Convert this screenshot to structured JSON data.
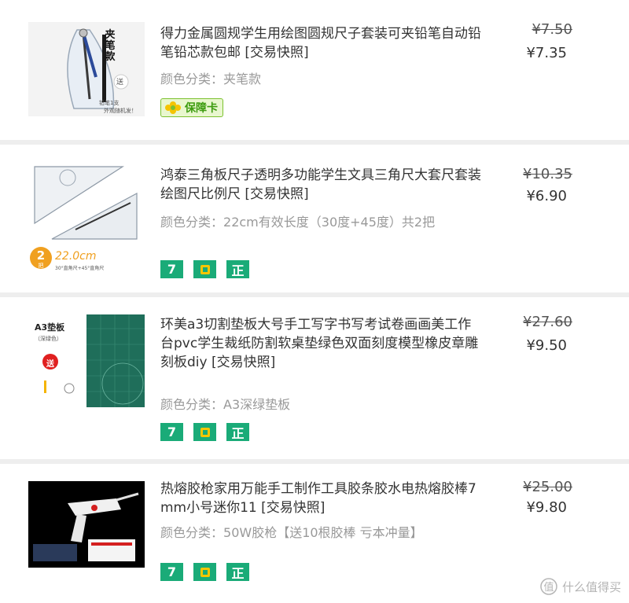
{
  "products": [
    {
      "title": "得力金属圆规学生用绘图圆规尺子套装可夹铅笔自动铅笔铅芯款包邮 [交易快照]",
      "variant_label": "颜色分类：",
      "variant_value": "夹笔款",
      "original_price": "¥7.50",
      "price": "¥7.35",
      "thumb_text": [
        "夹笔款",
        "送",
        "铅笔1支",
        "外观随机发！"
      ],
      "warranty_label": "保障卡"
    },
    {
      "title": "鸿泰三角板尺子透明多功能学生文具三角尺大套尺套装绘图尺比例尺 [交易快照]",
      "variant_label": "颜色分类：",
      "variant_value": "22cm有效长度（30度+45度）共2把",
      "original_price": "¥10.35",
      "price": "¥6.90",
      "thumb_text": [
        "2",
        "把",
        "22.0cm",
        "30°直角尺+45°直角尺"
      ],
      "badges": [
        "7",
        "shield",
        "正"
      ]
    },
    {
      "title": "环美a3切割垫板大号手工写字书写考试卷画画美工作台pvc学生裁纸防割软桌垫绿色双面刻度模型橡皮章雕刻板diy [交易快照]",
      "variant_label": "颜色分类：",
      "variant_value": "A3深绿垫板",
      "original_price": "¥27.60",
      "price": "¥9.50",
      "thumb_text": [
        "A3垫板",
        "（深绿色）",
        "送"
      ],
      "badges": [
        "7",
        "shield",
        "正"
      ]
    },
    {
      "title": "热熔胶枪家用万能手工制作工具胶条胶水电热熔胶棒7mm小号迷你11 [交易快照]",
      "variant_label": "颜色分类：",
      "variant_value": "50W胶枪【送10根胶棒 亏本冲量】",
      "original_price": "¥25.00",
      "price": "¥9.80",
      "badges": [
        "7",
        "shield",
        "正"
      ]
    }
  ],
  "watermark": {
    "icon": "smzdm-logo-icon",
    "text": "什么值得买"
  },
  "colors": {
    "badge_green": "#1aab78",
    "text_main": "#333333",
    "text_muted": "#999999",
    "separator": "#eeeeee"
  }
}
